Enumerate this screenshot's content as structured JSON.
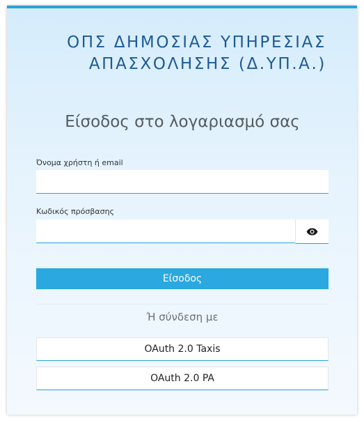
{
  "header": {
    "title_line1": "ΟΠΣ ΔΗΜΟΣΙΑΣ ΥΠΗΡΕΣΙΑΣ",
    "title_line2": "ΑΠΑΣΧΟΛΗΣΗΣ (Δ.ΥΠ.Α.)"
  },
  "login": {
    "heading": "Είσοδος στο λογαριασμό σας",
    "username_label": "Όνομα χρήστη ή email",
    "username_value": "",
    "password_label": "Κωδικός πρόσβασης",
    "password_value": "",
    "show_password_icon": "eye-icon",
    "submit_label": "Είσοδος"
  },
  "alt_login": {
    "or_text": "Ή σύνδεση με",
    "providers": [
      {
        "label": "OAuth 2.0 Taxis"
      },
      {
        "label": "OAuth 2.0 PA"
      }
    ]
  },
  "colors": {
    "accent": "#2aa2d9",
    "title": "#1e5a94",
    "button": "#2aa8df"
  }
}
